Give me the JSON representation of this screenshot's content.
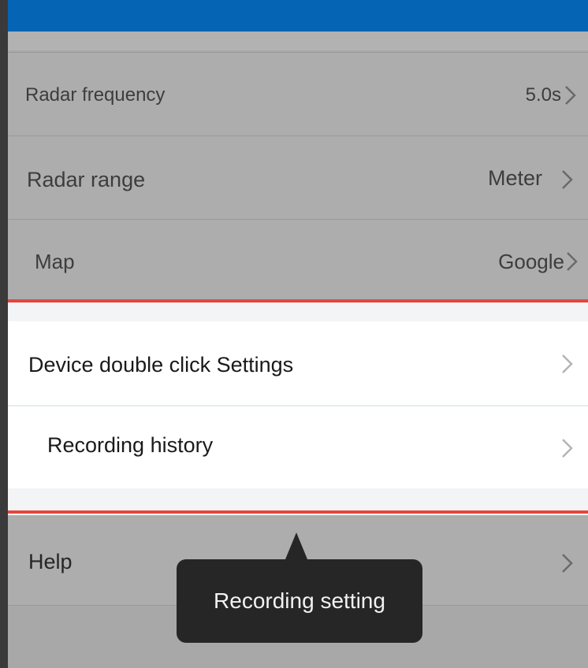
{
  "settings": {
    "radar_frequency": {
      "label": "Radar frequency",
      "value": "5.0s"
    },
    "radar_range": {
      "label": "Radar range",
      "value": "Meter"
    },
    "map": {
      "label": "Map",
      "value": "Google"
    },
    "device_double_click": {
      "label": "Device double click Settings"
    },
    "recording_history": {
      "label": "Recording history"
    },
    "help": {
      "label": "Help"
    }
  },
  "tooltip": {
    "text": "Recording setting"
  },
  "colors": {
    "header_blue": "#0565b4",
    "highlight_red": "#e3463d",
    "overlay_gray": "#a8a8a8",
    "tooltip_bg": "#262626"
  },
  "icons": [
    "chevron-right-icon"
  ]
}
